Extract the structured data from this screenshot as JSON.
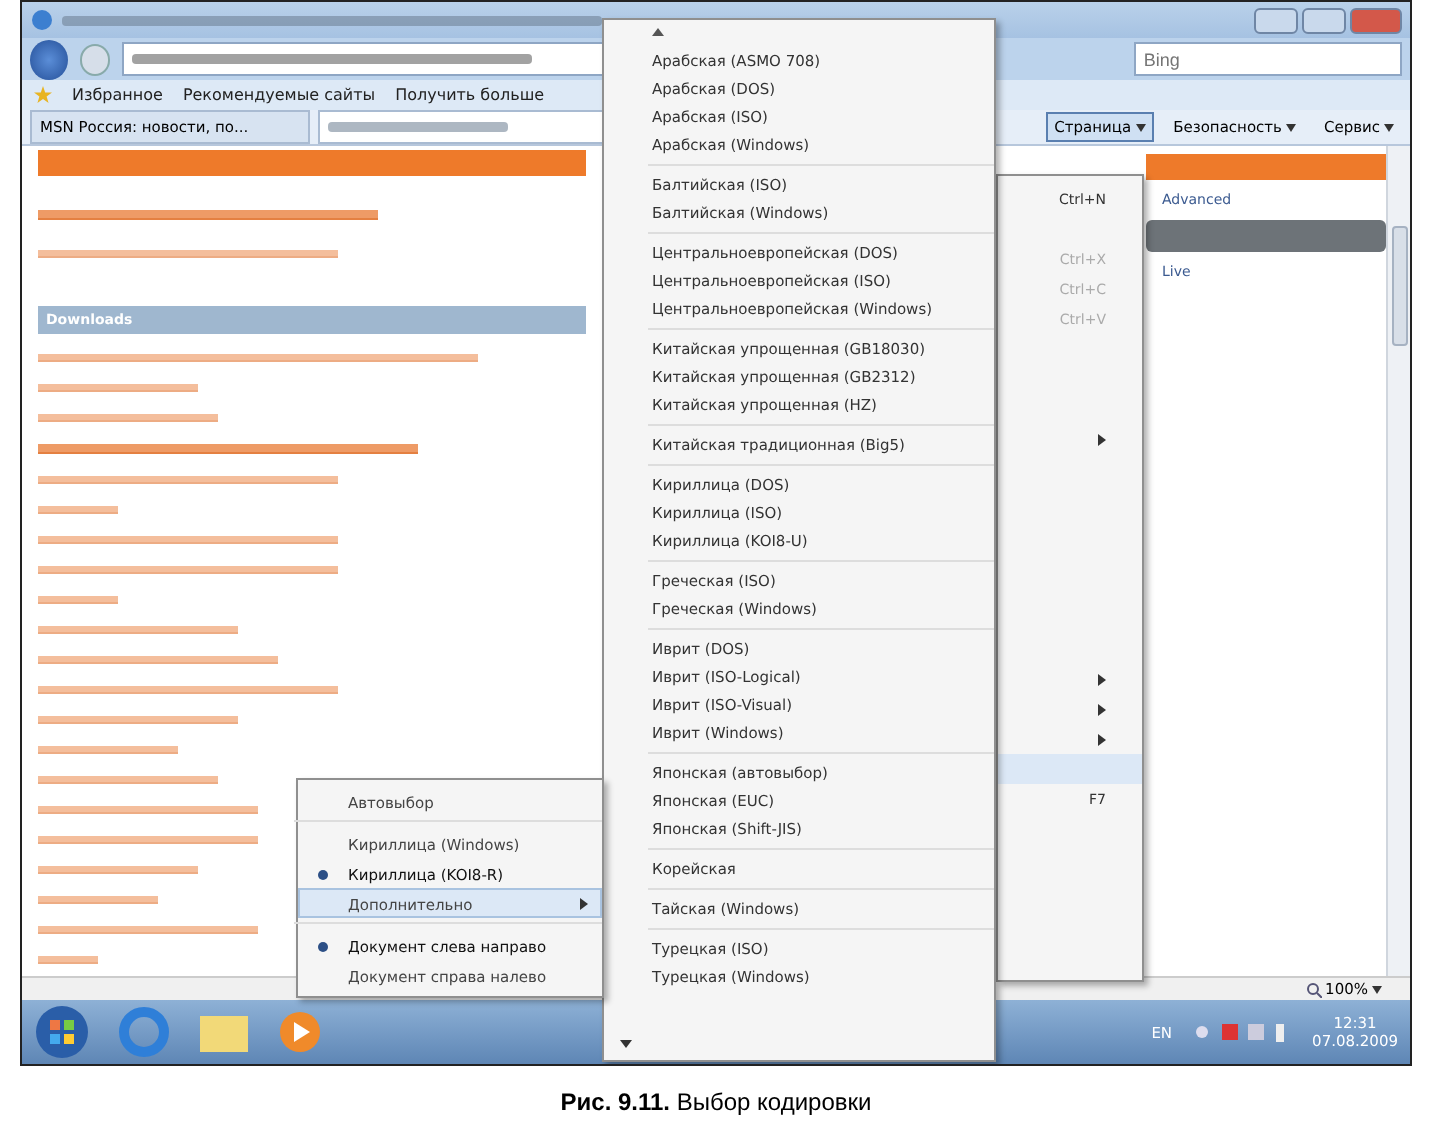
{
  "browser": {
    "favorites_bar": {
      "favorites": "Избранное",
      "items": [
        "Рекомендуемые сайты",
        "Получить больше"
      ]
    },
    "tabs": [
      {
        "label": "MSN Россия: новости, по...",
        "selected": false
      },
      {
        "selected": true
      }
    ],
    "search": {
      "placeholder": "Bing"
    },
    "command_bar": [
      {
        "label": "Страница",
        "selected": true
      },
      {
        "label": "Безопасность",
        "selected": false
      },
      {
        "label": "Сервис",
        "selected": false
      }
    ],
    "content": {
      "header": "Downloads",
      "right_texts": [
        "Advanced",
        "Live"
      ]
    },
    "status_bar": {
      "zoom": "100%"
    }
  },
  "page_menu": {
    "rows": [
      {
        "kind": "shortcut",
        "text": "Ctrl+N",
        "disabled": false
      },
      {
        "kind": "gap"
      },
      {
        "kind": "shortcut",
        "text": "Ctrl+X",
        "disabled": true
      },
      {
        "kind": "shortcut",
        "text": "Ctrl+C",
        "disabled": true
      },
      {
        "kind": "shortcut",
        "text": "Ctrl+V",
        "disabled": true
      },
      {
        "kind": "gap"
      },
      {
        "kind": "gap"
      },
      {
        "kind": "gap"
      },
      {
        "kind": "arrow"
      },
      {
        "kind": "gap"
      },
      {
        "kind": "gap"
      },
      {
        "kind": "gap"
      },
      {
        "kind": "gap"
      },
      {
        "kind": "gap"
      },
      {
        "kind": "gap"
      },
      {
        "kind": "gap"
      },
      {
        "kind": "arrow"
      },
      {
        "kind": "arrow"
      },
      {
        "kind": "arrow"
      },
      {
        "kind": "highlight"
      },
      {
        "kind": "shortcut",
        "text": "F7",
        "disabled": false
      }
    ]
  },
  "encoding_menu": {
    "groups": [
      [
        "Арабская (ASMO 708)",
        "Арабская (DOS)",
        "Арабская (ISO)",
        "Арабская (Windows)"
      ],
      [
        "Балтийская (ISO)",
        "Балтийская (Windows)"
      ],
      [
        "Центральноевропейская (DOS)",
        "Центральноевропейская (ISO)",
        "Центральноевропейская (Windows)"
      ],
      [
        "Китайская упрощенная (GB18030)",
        "Китайская упрощенная (GB2312)",
        "Китайская упрощенная (HZ)"
      ],
      [
        "Китайская традиционная (Big5)"
      ],
      [
        "Кириллица (DOS)",
        "Кириллица (ISO)",
        "Кириллица (KOI8-U)"
      ],
      [
        "Греческая (ISO)",
        "Греческая (Windows)"
      ],
      [
        "Иврит (DOS)",
        "Иврит (ISO-Logical)",
        "Иврит (ISO-Visual)",
        "Иврит (Windows)"
      ],
      [
        "Японская (автовыбор)",
        "Японская (EUC)",
        "Японская (Shift-JIS)"
      ],
      [
        "Корейская"
      ],
      [
        "Тайская (Windows)"
      ],
      [
        "Турецкая (ISO)",
        "Турецкая (Windows)"
      ]
    ]
  },
  "encoding_submenu": {
    "groups": [
      [
        {
          "kind": "plain",
          "label": "Автовыбор"
        }
      ],
      [
        {
          "kind": "radio",
          "label": "Кириллица (Windows)",
          "selected": false
        },
        {
          "kind": "radio",
          "label": "Кириллица (KOI8-R)",
          "selected": true
        },
        {
          "kind": "submenu",
          "label": "Дополнительно",
          "highlighted": true
        }
      ],
      [
        {
          "kind": "radio",
          "label": "Документ слева направо",
          "selected": true
        },
        {
          "kind": "radio",
          "label": "Документ справа налево",
          "selected": false
        }
      ]
    ]
  },
  "taskbar": {
    "language": "EN",
    "time": "12:31",
    "date": "07.08.2009"
  },
  "caption": "**Рис. 9.11.** Выбор кодировки"
}
